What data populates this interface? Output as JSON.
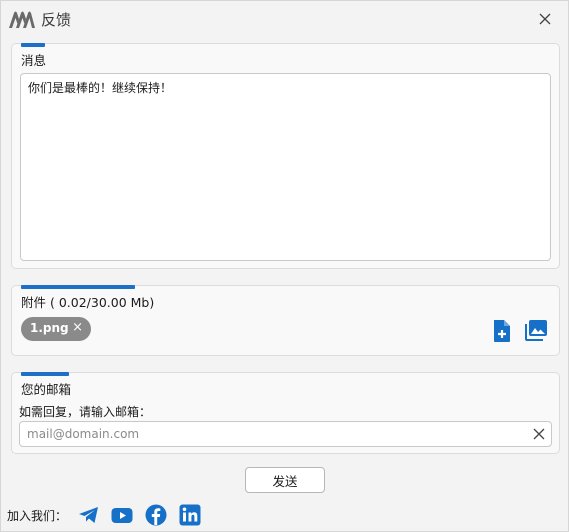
{
  "window": {
    "title": "反馈"
  },
  "message": {
    "title": "消息",
    "text": "你们是最棒的！继续保持！"
  },
  "attachments": {
    "title": "附件 ( 0.02/30.00 Mb)",
    "files": [
      {
        "name": "1.png"
      }
    ],
    "remove_symbol": "×",
    "actions": [
      "add-file-icon",
      "add-image-icon"
    ]
  },
  "email": {
    "title": "您的邮箱",
    "hint": "如需回复，请输入邮箱：",
    "placeholder": "mail@domain.com",
    "value": ""
  },
  "send_button": {
    "label": "发送"
  },
  "footer": {
    "join_label": "加入我们：",
    "social": [
      "telegram-icon",
      "youtube-icon",
      "facebook-icon",
      "linkedin-icon"
    ]
  },
  "colors": {
    "accent": "#1e6fc7",
    "chip": "#8a8a8a",
    "social_blue": "#1670c8"
  }
}
